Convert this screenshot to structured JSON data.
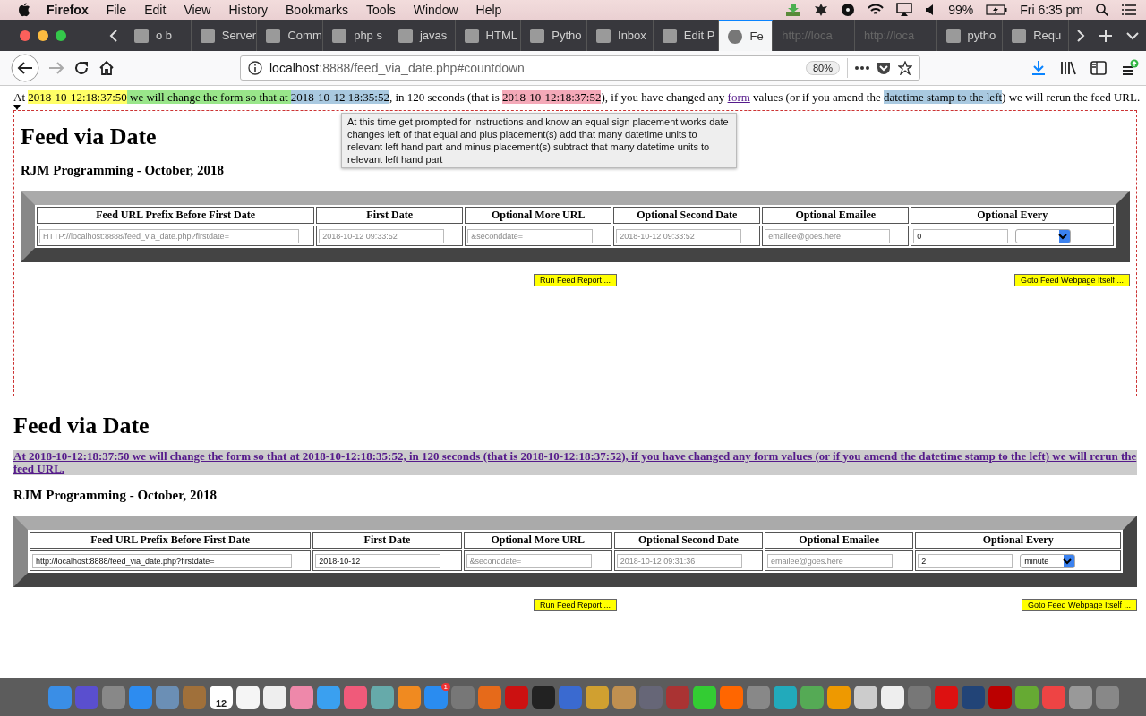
{
  "menubar": {
    "app": "Firefox",
    "menus": [
      "File",
      "Edit",
      "View",
      "History",
      "Bookmarks",
      "Tools",
      "Window",
      "Help"
    ],
    "battery": "99%",
    "clock": "Fri 6:35 pm"
  },
  "tabs": [
    {
      "label": "o b",
      "selected": false
    },
    {
      "label": "Server",
      "selected": false
    },
    {
      "label": "Comm",
      "selected": false
    },
    {
      "label": "php s",
      "selected": false
    },
    {
      "label": "javas",
      "selected": false
    },
    {
      "label": "HTML",
      "selected": false
    },
    {
      "label": "Pytho",
      "selected": false
    },
    {
      "label": "Inbox",
      "selected": false
    },
    {
      "label": "Edit P",
      "selected": false
    },
    {
      "label": "Fe",
      "selected": true
    },
    {
      "label": "http://loca",
      "selected": false
    },
    {
      "label": "http://loca",
      "selected": false
    },
    {
      "label": "pytho",
      "selected": false
    },
    {
      "label": "Requ",
      "selected": false
    }
  ],
  "address_bar": {
    "url_host": "localhost",
    "url_rest": ":8888/feed_via_date.php#countdown",
    "zoom": "80%"
  },
  "countdown": [
    {
      "text": "At "
    },
    {
      "text": "2018-10-12:18:37:50",
      "color": "#ffff66"
    },
    {
      "text": " we will change the form so that at ",
      "color": "#99e68a"
    },
    {
      "text": "2018-10-12 18:35:52",
      "color": "#a9c9e0"
    },
    {
      "text": ", in 120 seconds (that is "
    },
    {
      "text": "2018-10-12:18:37:52",
      "color": "#f4a9b8"
    },
    {
      "text": "), if you have changed any "
    },
    {
      "text": "form",
      "kind": "link"
    },
    {
      "text": " values (or if you amend the "
    },
    {
      "text": "datetime stamp to the left",
      "color": "#a9c9e0"
    },
    {
      "text": ") we will rerun the feed URL."
    }
  ],
  "tooltip": "At this time get prompted for instructions and know an equal sign placement works date changes left of that equal and plus placement(s) add that many datetime units to relevant left hand part and minus placement(s) subtract that many datetime units to relevant left hand part",
  "sections": [
    {
      "kind": "framed",
      "title": "Feed via Date",
      "subtitle": "RJM Programming - October, 2018",
      "form": {
        "columns": [
          "Feed URL Prefix Before First Date",
          "First Date",
          "Optional More URL",
          "Optional Second Date",
          "Optional Emailee",
          "Optional Every"
        ],
        "cells": [
          [
            {
              "kind": "text",
              "placeholder": "HTTP://localhost:8888/feed_via_date.php?firstdate="
            }
          ],
          [
            {
              "kind": "text",
              "placeholder": "2018-10-12 09:33:52"
            }
          ],
          [
            {
              "kind": "text",
              "placeholder": "&seconddate="
            }
          ],
          [
            {
              "kind": "text",
              "placeholder": "2018-10-12 09:33:52"
            }
          ],
          [
            {
              "kind": "text",
              "placeholder": "emailee@goes.here"
            }
          ],
          [
            {
              "kind": "number",
              "value": "0"
            },
            {
              "kind": "select"
            }
          ]
        ]
      },
      "buttons": [
        "Run Feed Report ...",
        "Goto Feed Webpage Itself ..."
      ]
    },
    {
      "kind": "plain",
      "title": "Feed via Date",
      "link": "At 2018-10-12:18:37:50 we will change the form so that at 2018-10-12:18:35:52, in 120 seconds (that is 2018-10-12:18:37:52), if you have changed any form values (or if you amend the datetime stamp to the left) we will rerun the feed URL.",
      "subtitle": "RJM Programming - October, 2018",
      "form": {
        "columns": [
          "Feed URL Prefix Before First Date",
          "First Date",
          "Optional More URL",
          "Optional Second Date",
          "Optional Emailee",
          "Optional Every"
        ],
        "cells": [
          [
            {
              "kind": "text",
              "value": "http://localhost:8888/feed_via_date.php?firstdate="
            }
          ],
          [
            {
              "kind": "text",
              "value": "2018-10-12"
            }
          ],
          [
            {
              "kind": "text",
              "placeholder": "&seconddate="
            }
          ],
          [
            {
              "kind": "text",
              "placeholder": "2018-10-12 09:31:36"
            }
          ],
          [
            {
              "kind": "text",
              "placeholder": "emailee@goes.here"
            }
          ],
          [
            {
              "kind": "number",
              "value": "2"
            },
            {
              "kind": "select",
              "value": "minute"
            }
          ]
        ]
      },
      "buttons": [
        "Run Feed Report ...",
        "Goto Feed Webpage Itself ..."
      ]
    }
  ],
  "dock": {
    "calendar_day": "12",
    "badge": "1"
  }
}
